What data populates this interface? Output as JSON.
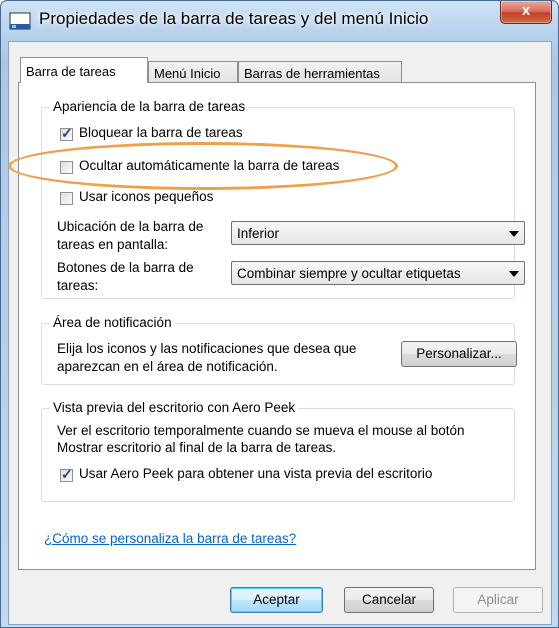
{
  "window": {
    "title": "Propiedades de la barra de tareas y del menú Inicio",
    "close_glyph": "x"
  },
  "tabs": [
    {
      "label": "Barra de tareas",
      "active": true
    },
    {
      "label": "Menú Inicio",
      "active": false
    },
    {
      "label": "Barras de herramientas",
      "active": false
    }
  ],
  "appearance": {
    "title": "Apariencia de la barra de tareas",
    "lock": {
      "label": "Bloquear la barra de tareas",
      "checked": true
    },
    "autohide": {
      "label": "Ocultar automáticamente la barra de tareas",
      "checked": false
    },
    "small_icons": {
      "label": "Usar iconos pequeños",
      "checked": false
    },
    "location": {
      "label_line1": "Ubicación de la barra de",
      "label_line2": "tareas en pantalla:",
      "value": "Inferior"
    },
    "buttons": {
      "label_line1": "Botones de la barra de",
      "label_line2": "tareas:",
      "value": "Combinar siempre y ocultar etiquetas"
    }
  },
  "notification": {
    "title": "Área de notificación",
    "text_line1": "Elija los iconos y las notificaciones que desea que",
    "text_line2": "aparezcan en el área de notificación.",
    "customize_label": "Personalizar..."
  },
  "peek": {
    "title": "Vista previa del escritorio con Aero Peek",
    "text_line1": "Ver el escritorio temporalmente cuando se mueva el mouse al botón",
    "text_line2": "Mostrar escritorio al final de la barra de tareas.",
    "use_peek": {
      "label": "Usar Aero Peek para obtener una vista previa del escritorio",
      "checked": true
    }
  },
  "help_link": "¿Cómo se personaliza la barra de tareas?",
  "footer": {
    "ok_label": "Aceptar",
    "cancel_label": "Cancelar",
    "apply_label": "Aplicar",
    "apply_enabled": false
  },
  "colors": {
    "highlight": "#f0a04b",
    "link": "#0066cc",
    "check": "#23467e"
  },
  "icons": {
    "title": "taskbar-icon",
    "close": "close-icon",
    "dropdown": "chevron-down-icon"
  }
}
